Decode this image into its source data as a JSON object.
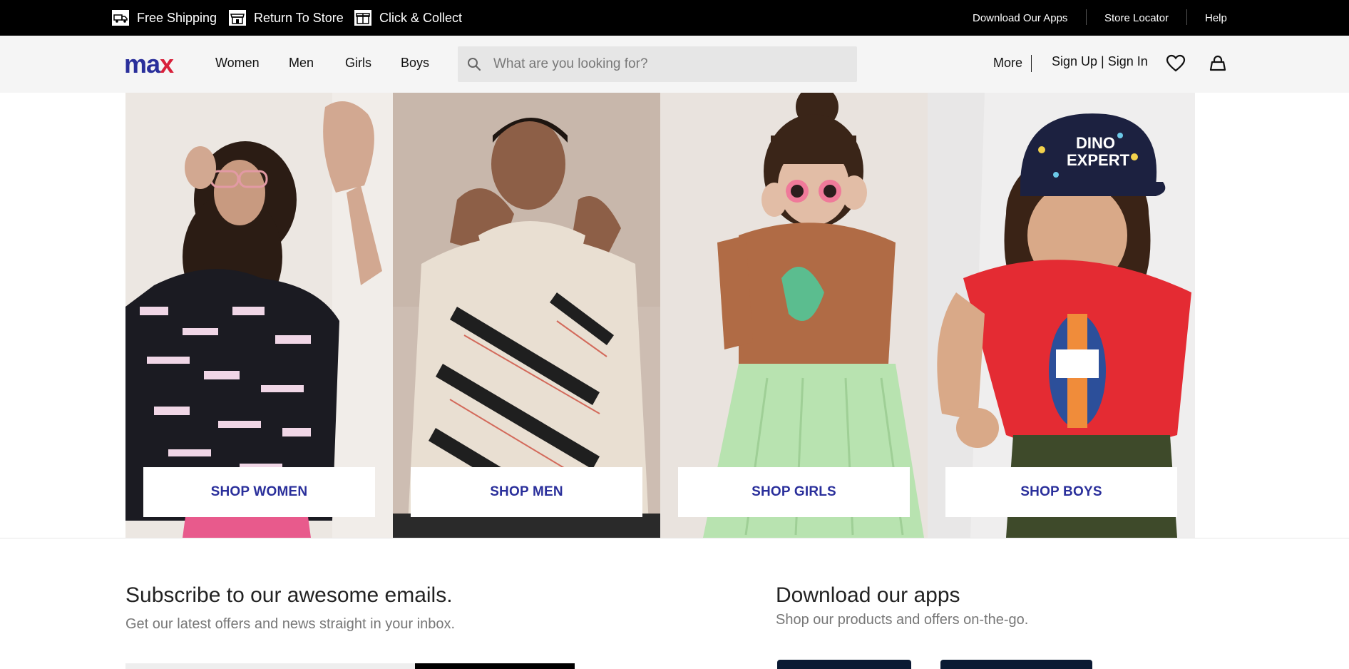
{
  "topbar": {
    "perks": [
      {
        "icon": "truck-icon",
        "label": "Free Shipping"
      },
      {
        "icon": "store-icon",
        "label": "Return To Store"
      },
      {
        "icon": "gift-box-icon",
        "label": "Click & Collect"
      }
    ],
    "links": [
      "Download Our Apps",
      "Store Locator",
      "Help"
    ]
  },
  "header": {
    "logo": {
      "text_main": "ma",
      "text_accent": "x"
    },
    "nav": [
      "Women",
      "Men",
      "Girls",
      "Boys"
    ],
    "search": {
      "placeholder": "What are you looking for?",
      "value": ""
    },
    "more_label": "More",
    "account_label": "Sign Up | Sign In",
    "icons": [
      "heart-icon",
      "bag-icon"
    ]
  },
  "hero": {
    "tiles": [
      {
        "cta": "SHOP WOMEN",
        "image_desc": "woman in printed shirt and pink trousers"
      },
      {
        "cta": "SHOP MEN",
        "image_desc": "man in printed hoodie"
      },
      {
        "cta": "SHOP GIRLS",
        "image_desc": "girl with sunglasses and green skirt"
      },
      {
        "cta": "SHOP BOYS",
        "image_desc": "boy in red t-shirt and cap"
      }
    ]
  },
  "subscribe": {
    "title": "Subscribe to our awesome emails.",
    "subtitle": "Get our latest offers and news straight in your inbox."
  },
  "apps": {
    "title": "Download our apps",
    "subtitle": "Shop our products and offers on-the-go."
  },
  "colors": {
    "brand_blue": "#2a2f9b",
    "brand_red": "#d8203a",
    "topbar_bg": "#000000",
    "header_bg": "#f5f5f5"
  }
}
